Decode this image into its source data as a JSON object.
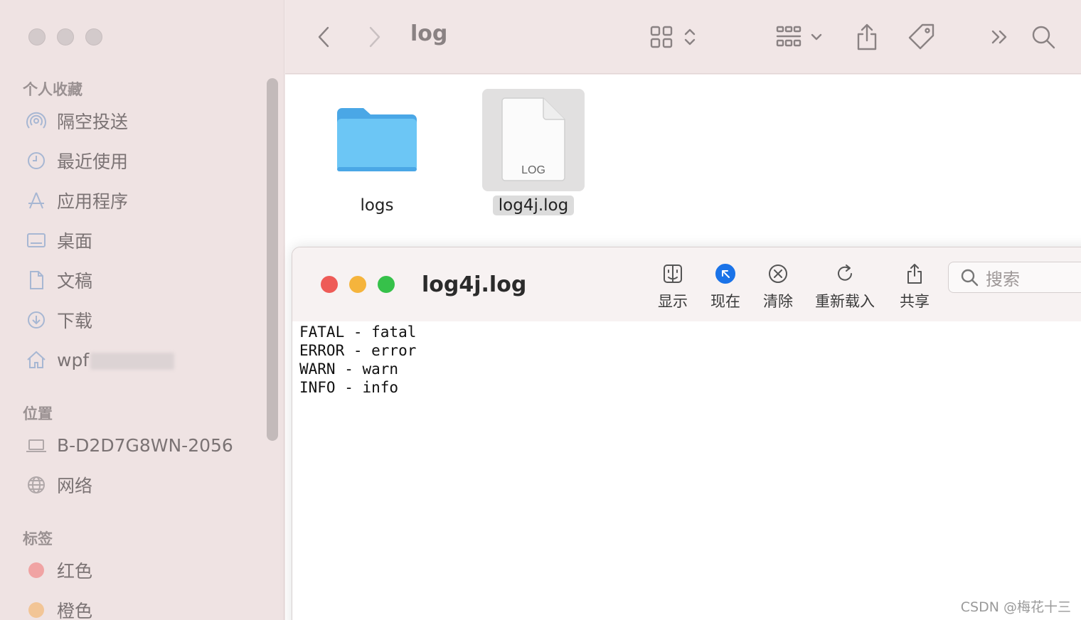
{
  "sidebar": {
    "favorites_title": "个人收藏",
    "favorites": [
      {
        "label": "隔空投送",
        "icon": "airdrop-icon"
      },
      {
        "label": "最近使用",
        "icon": "clock-icon"
      },
      {
        "label": "应用程序",
        "icon": "applications-icon"
      },
      {
        "label": "桌面",
        "icon": "desktop-icon"
      },
      {
        "label": "文稿",
        "icon": "document-icon"
      },
      {
        "label": "下载",
        "icon": "download-icon"
      },
      {
        "label": "wpf",
        "icon": "home-icon"
      }
    ],
    "locations_title": "位置",
    "locations": [
      {
        "label": "B-D2D7G8WN-2056",
        "icon": "laptop-icon"
      },
      {
        "label": "网络",
        "icon": "network-icon"
      }
    ],
    "tags_title": "标签",
    "tags": [
      {
        "label": "红色",
        "color": "#f0a3a3"
      },
      {
        "label": "橙色",
        "color": "#f2c596"
      }
    ]
  },
  "toolbar": {
    "title": "log"
  },
  "files": [
    {
      "name": "logs",
      "kind": "folder",
      "selected": false
    },
    {
      "name": "log4j.log",
      "kind": "log",
      "badge": "LOG",
      "selected": true
    }
  ],
  "quicklook": {
    "title": "log4j.log",
    "buttons": {
      "show": "显示",
      "now": "现在",
      "clear": "清除",
      "reload": "重新载入",
      "share": "共享"
    },
    "search_placeholder": "搜索",
    "lines": [
      "FATAL - fatal",
      "ERROR - error",
      "WARN - warn",
      "INFO - info"
    ]
  },
  "watermark": "CSDN @梅花十三",
  "colors": {
    "close": "#ee5b57",
    "minimize": "#f5b43c",
    "zoom": "#36c14a",
    "accent": "#1a73e8",
    "folder": "#6cc6f5"
  }
}
